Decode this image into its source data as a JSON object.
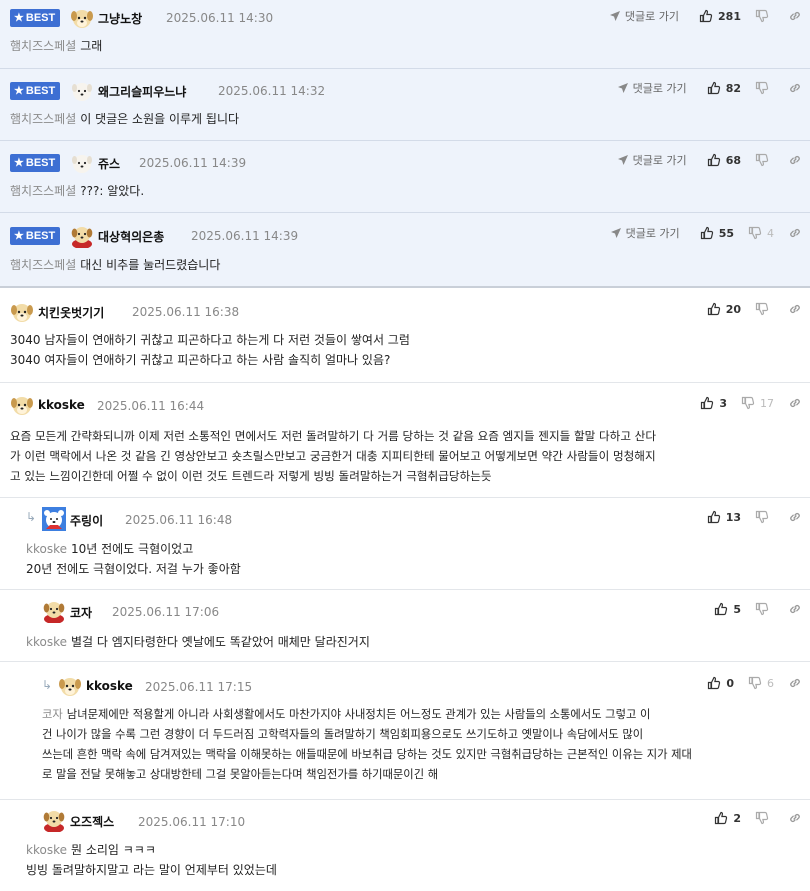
{
  "ui": {
    "best_badge": "BEST",
    "reply_goto": "댓글로 가기"
  },
  "comments": [
    {
      "nick": "그냥노창",
      "date": "2025.06.11 14:30",
      "mention": "햄치즈스페셜",
      "text": [
        "그래"
      ],
      "up": "281",
      "down": ""
    },
    {
      "nick": "왜그리슬피우느냐",
      "date": "2025.06.11 14:32",
      "mention": "햄치즈스페셜",
      "text": [
        "이 댓글은 소원을 이루게 됩니다"
      ],
      "up": "82",
      "down": ""
    },
    {
      "nick": "쥬스",
      "date": "2025.06.11 14:39",
      "mention": "햄치즈스페셜",
      "text": [
        "???: 알았다."
      ],
      "up": "68",
      "down": ""
    },
    {
      "nick": "대상혁의은총",
      "date": "2025.06.11 14:39",
      "mention": "햄치즈스페셜",
      "text": [
        "대신 비추를 눌러드렸습니다"
      ],
      "up": "55",
      "down": "4"
    },
    {
      "nick": "치킨옷벗기기",
      "date": "2025.06.11 16:38",
      "mention": "",
      "text": [
        "3040 남자들이 연애하기 귀찮고 피곤하다고 하는게 다 저런 것들이 쌓여서 그럼",
        "3040 여자들이 연애하기 귀찮고 피곤하다고 하는 사람 솔직히 얼마나 있음?"
      ],
      "up": "20",
      "down": ""
    },
    {
      "nick": "kkoske",
      "date": "2025.06.11 16:44",
      "mention": "",
      "text": [
        "요즘 모든게 간략화되니까 이제 저런 소통적인 면에서도 저런 돌려말하기 다 거름 당하는 것 같음 요즘 엠지들 젠지들 할말 다하고 산다",
        "가 이런 맥락에서 나온 것 같음 긴 영상안보고 숏츠릴스만보고 궁금한거 대충 지피티한테 물어보고 어떻게보면 약간 사람들이 멍청해지",
        "고 있는 느낌이긴한데 어쩔 수 없이 이런 것도 트렌드라 저렇게 빙빙 돌려말하는거 극혐취급당하는듯"
      ],
      "up": "3",
      "down": "17"
    },
    {
      "nick": "주링이",
      "date": "2025.06.11 16:48",
      "mention": "kkoske",
      "text": [
        "10년 전에도 극혐이었고",
        "20년 전에도 극혐이었다. 저걸 누가 좋아함"
      ],
      "up": "13",
      "down": ""
    },
    {
      "nick": "코자",
      "date": "2025.06.11 17:06",
      "mention": "kkoske",
      "text": [
        "별걸 다 엠지타령한다 옛날에도 똑같았어 매체만 달라진거지"
      ],
      "up": "5",
      "down": ""
    },
    {
      "nick": "kkoske",
      "date": "2025.06.11 17:15",
      "mention": "코자",
      "text": [
        "남녀문제에만 적용할게 아니라 사회생활에서도 마찬가지야 사내정치든 어느정도 관계가 있는 사람들의 소통에서도 그렇고 이",
        "건 나이가 많을 수록 그런 경향이 더 두드러짐 고학력자들의 돌려말하기 책임회피용으로도 쓰기도하고 옛말이나 속담에서도 많이",
        "쓰는데 흔한 맥락 속에 담겨져있는 맥락을 이해못하는 애들때문에 바보취급 당하는 것도 있지만 극혐취급당하는 근본적인 이유는 지가 제대",
        "로 말을 전달 못해놓고 상대방한테 그걸 못알아듣는다며 책임전가를 하기때문이긴 해"
      ],
      "up": "0",
      "down": "6"
    },
    {
      "nick": "오즈젝스",
      "date": "2025.06.11 17:10",
      "mention": "kkoske",
      "text": [
        "뭔 소리임 ㅋㅋㅋ",
        "빙빙 돌려말하지말고 라는 말이 언제부터 있었는데"
      ],
      "up": "2",
      "down": ""
    }
  ]
}
